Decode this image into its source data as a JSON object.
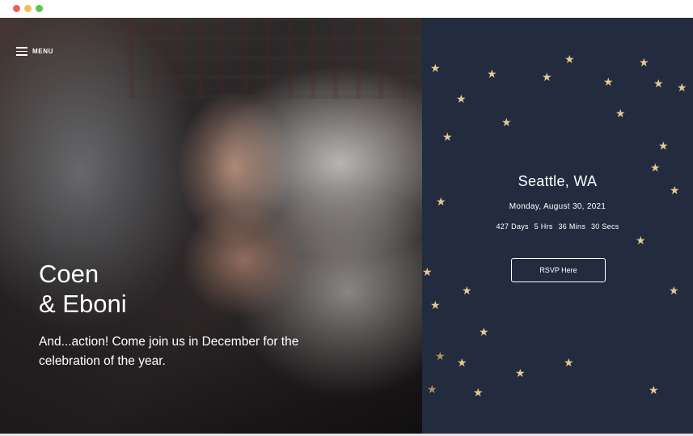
{
  "window": {
    "controls": [
      "close",
      "minimize",
      "maximize"
    ]
  },
  "header": {
    "menu_label": "MENU",
    "menu_icon": "hamburger-icon"
  },
  "hero": {
    "name_line1": "Coen",
    "name_line2": "& Eboni",
    "tagline": "And...action! Come join us in December for the celebration of the year."
  },
  "event": {
    "city": "Seattle, WA",
    "date": "Monday, August 30, 2021",
    "countdown": {
      "days": "427 Days",
      "hours": "5 Hrs",
      "mins": "36 Mins",
      "secs": "30 Secs"
    },
    "rsvp_label": "RSVP Here"
  },
  "colors": {
    "panel_bg": "#232b3f",
    "star": "#e8c98e",
    "text": "#ffffff"
  }
}
